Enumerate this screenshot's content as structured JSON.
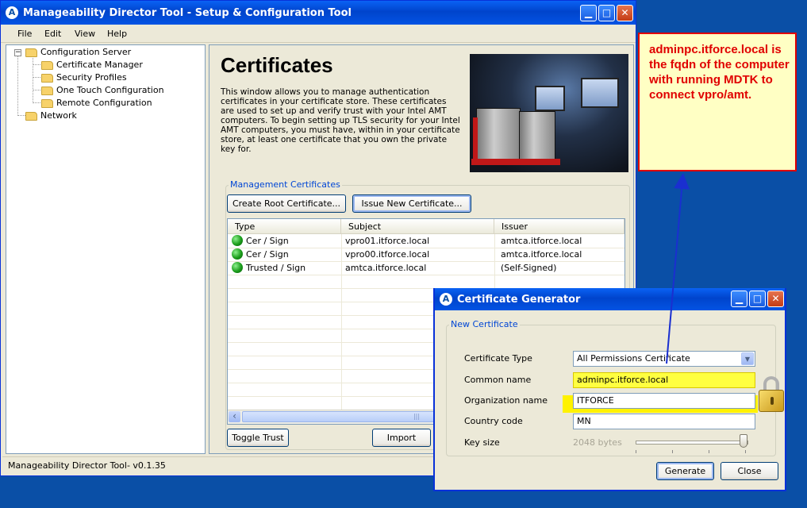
{
  "main_window": {
    "title": "Manageability Director Tool - Setup & Configuration Tool",
    "app_icon": "A",
    "controls": {
      "minimize": "▁",
      "maximize": "□",
      "close": "✕"
    }
  },
  "menu": [
    "File",
    "Edit",
    "View",
    "Help"
  ],
  "tree": {
    "root": {
      "label": "Configuration Server",
      "expander": "−"
    },
    "children": [
      "Certificate Manager",
      "Security Profiles",
      "One Touch Configuration",
      "Remote Configuration"
    ],
    "sibling": "Network"
  },
  "content": {
    "title": "Certificates",
    "intro": "This window allows you to manage authentication certificates in your certificate store. These certificates are used to set up and verify trust with your Intel AMT computers. To begin setting up TLS security for your Intel AMT computers, you must have, within in your certificate store, at least one certificate that you own the private key for.",
    "group_label": "Management Certificates",
    "buttons": {
      "create_root": "Create Root Certificate...",
      "issue_new": "Issue New Certificate...",
      "toggle_trust": "Toggle Trust",
      "import": "Import"
    },
    "table": {
      "columns": [
        "Type",
        "Subject",
        "Issuer"
      ],
      "rows": [
        {
          "type": "Cer / Sign",
          "subject": "vpro01.itforce.local",
          "issuer": "amtca.itforce.local"
        },
        {
          "type": "Cer / Sign",
          "subject": "vpro00.itforce.local",
          "issuer": "amtca.itforce.local"
        },
        {
          "type": "Trusted / Sign",
          "subject": "amtca.itforce.local",
          "issuer": "(Self-Signed)"
        }
      ],
      "scroll_left": "‹",
      "scroll_grip": "|||"
    }
  },
  "status_bar": "Manageability Director Tool- v0.1.35",
  "annotation": "adminpc.itforce.local is the fqdn of the computer with running MDTK to connect vpro/amt.",
  "dialog": {
    "title": "Certificate Generator",
    "group_label": "New Certificate",
    "fields": {
      "certificate_type": {
        "label": "Certificate Type",
        "value": "All Permissions Certificate"
      },
      "common_name": {
        "label": "Common name",
        "value": "adminpc.itforce.local"
      },
      "organization_name": {
        "label": "Organization name",
        "value": "ITFORCE"
      },
      "country_code": {
        "label": "Country code",
        "value": "MN"
      },
      "key_size": {
        "label": "Key size",
        "value": "2048 bytes",
        "slider_level": 1.0
      }
    },
    "buttons": {
      "generate": "Generate",
      "close": "Close"
    }
  },
  "colors": {
    "desktop": "#0a4fa6",
    "annotation_text": "#e00000",
    "highlight": "#fff200",
    "arrow": "#1a2fd0"
  }
}
